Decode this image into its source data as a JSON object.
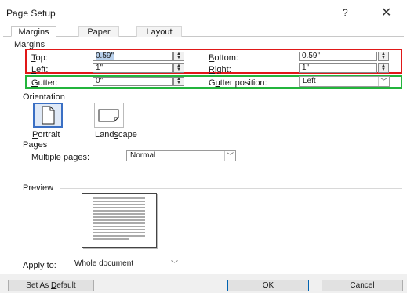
{
  "dialog": {
    "title": "Page Setup",
    "help_label": "?",
    "close_label": "✕"
  },
  "tabs": [
    {
      "label": "Margins"
    },
    {
      "label": "Paper"
    },
    {
      "label": "Layout"
    }
  ],
  "margins": {
    "section_label": "Margins",
    "top": {
      "label_ul": "T",
      "label_rest": "op:",
      "value": "0.59\""
    },
    "bottom": {
      "label_ul": "B",
      "label_rest": "ottom:",
      "value": "0.59\""
    },
    "left": {
      "label_ul": "L",
      "label_rest": "eft:",
      "value": "1\""
    },
    "right": {
      "label_ul": "R",
      "label_rest": "ight:",
      "value": "1\""
    },
    "gutter": {
      "label_ul": "G",
      "label_rest": "utter:",
      "value": "0\""
    },
    "gutter_position": {
      "label_pre": "G",
      "label_ul": "u",
      "label_rest": "tter position:",
      "value": "Left"
    }
  },
  "orientation": {
    "section_label": "Orientation",
    "portrait": {
      "label_ul": "P",
      "label_rest": "ortrait"
    },
    "landscape": {
      "label_pre": "Land",
      "label_ul": "s",
      "label_rest": "cape"
    }
  },
  "pages": {
    "section_label": "Pages",
    "multiple_label_ul": "M",
    "multiple_label_rest": "ultiple pages:",
    "multiple_value": "Normal"
  },
  "preview": {
    "section_label": "Preview"
  },
  "apply": {
    "label_pre": "Appl",
    "label_ul": "y",
    "label_rest": " to:",
    "value": "Whole document"
  },
  "buttons": {
    "default_pre": "Set As ",
    "default_ul": "D",
    "default_rest": "efault",
    "ok": "OK",
    "cancel": "Cancel"
  },
  "colors": {
    "highlight_red": "#e01818",
    "highlight_green": "#23b43c",
    "accent": "#0063b1"
  }
}
